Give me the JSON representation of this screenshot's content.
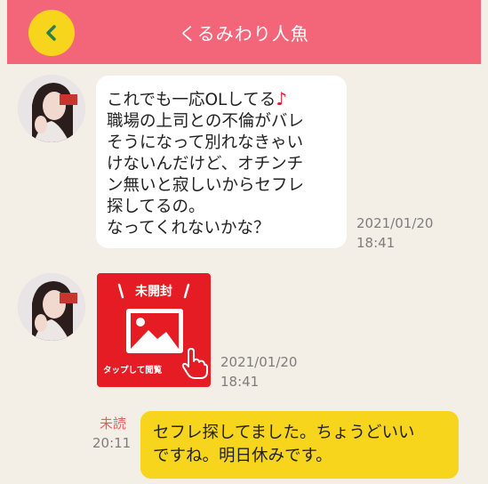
{
  "header": {
    "title": "くるみわり人魚"
  },
  "messages": [
    {
      "text": "これでも一応OLしてる",
      "note_icon": "♪",
      "text_rest": "職場の上司との不倫がバレ\nそうになって別れなきゃい\nけないんだけど、オチンチ\nン無いと寂しいからセフレ\n探してるの。\nなってくれないかな？",
      "timestamp": "2021/01/20\n18:41"
    },
    {
      "image_badge": "未開封",
      "image_caption": "タップして閲覧",
      "timestamp": "2021/01/20\n18:41"
    }
  ],
  "reply": {
    "status": "未読",
    "time": "20:11",
    "text": "セフレ探してました。ちょうどいい\nですね。明日休みです。"
  },
  "colors": {
    "header": "#f3667a",
    "back_button": "#f7d51d",
    "image_card": "#e51c23",
    "reply_bubble": "#f7d51d",
    "unread": "#e95c5c"
  }
}
